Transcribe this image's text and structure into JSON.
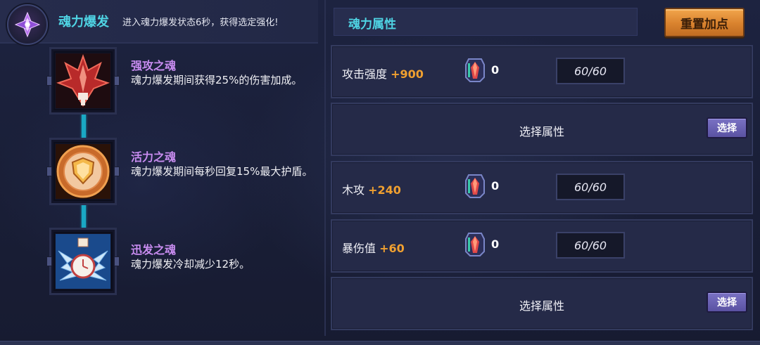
{
  "burst": {
    "title": "魂力爆发",
    "description": "进入魂力爆发状态6秒，获得选定强化!"
  },
  "souls": [
    {
      "name": "强攻之魂",
      "description": "魂力爆发期间获得25%的伤害加成。",
      "icon": "red-crest-icon"
    },
    {
      "name": "活力之魂",
      "description": "魂力爆发期间每秒回复15%最大护盾。",
      "icon": "shield-emblem-icon"
    },
    {
      "name": "迅发之魂",
      "description": "魂力爆发冷却减少12秒。",
      "icon": "winged-clock-icon"
    }
  ],
  "attributes": {
    "title": "魂力属性",
    "reset_label": "重置加点",
    "slots": [
      {
        "type": "stat",
        "label": "攻击强度",
        "bonus": "+900",
        "gem_count": "0",
        "level": "60/60"
      },
      {
        "type": "empty",
        "label": "选择属性",
        "button": "选择"
      },
      {
        "type": "stat",
        "label": "木攻",
        "bonus": "+240",
        "gem_count": "0",
        "level": "60/60"
      },
      {
        "type": "stat",
        "label": "暴伤值",
        "bonus": "+60",
        "gem_count": "0",
        "level": "60/60"
      },
      {
        "type": "empty",
        "label": "选择属性",
        "button": "选择"
      }
    ]
  },
  "colors": {
    "accent_cyan": "#4fd4e4",
    "soul_name": "#c88cf0",
    "bonus_orange": "#f0a030",
    "reset_orange": "#e08a36",
    "choose_purple": "#6a62b4"
  }
}
